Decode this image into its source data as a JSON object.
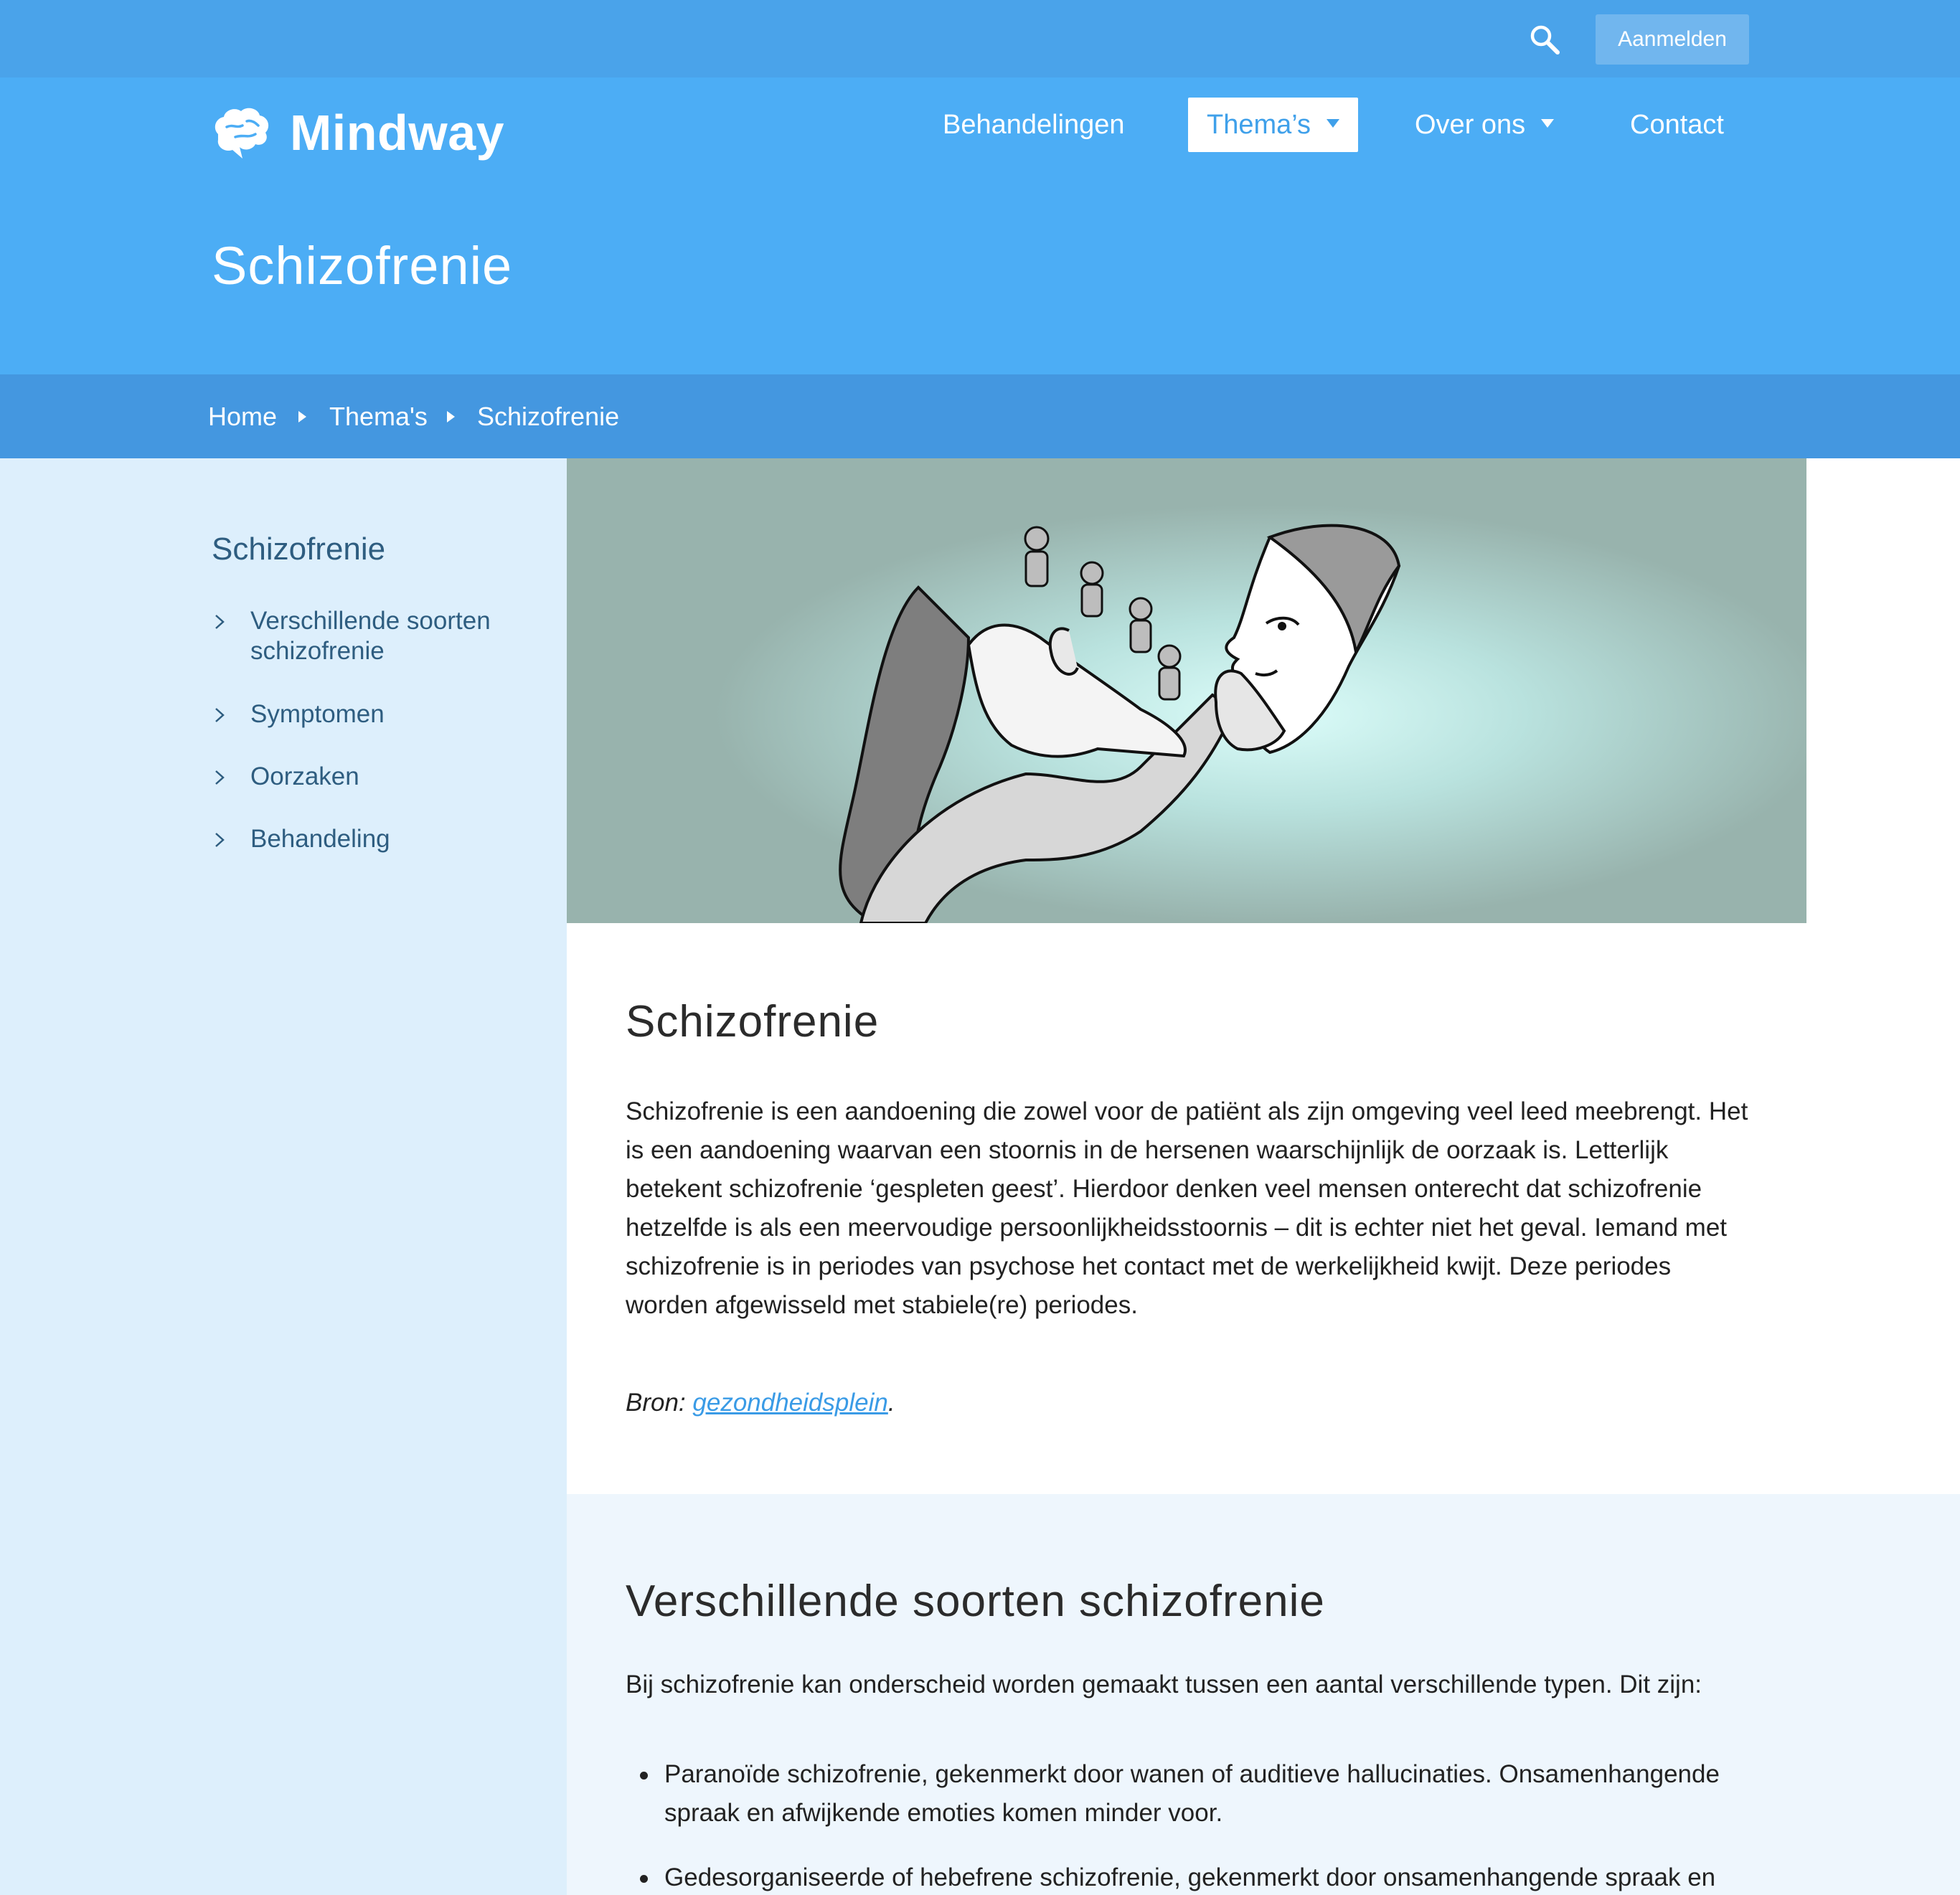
{
  "topbar": {
    "search_icon": "search-icon",
    "signin_label": "Aanmelden"
  },
  "brand": {
    "name": "Mindway",
    "icon": "brain-icon",
    "colors": {
      "topbar": "#4aa3ea",
      "header": "#4cadf5",
      "breadcrumb": "#4497e0",
      "sidebar": "#ddeffc",
      "link": "#3a9be6"
    }
  },
  "nav": {
    "items": [
      {
        "label": "Behandelingen",
        "dropdown": false,
        "active": false
      },
      {
        "label": "Thema’s",
        "dropdown": true,
        "active": true
      },
      {
        "label": "Over ons",
        "dropdown": true,
        "active": false
      },
      {
        "label": "Contact",
        "dropdown": false,
        "active": false
      }
    ]
  },
  "page": {
    "title": "Schizofrenie"
  },
  "breadcrumb": {
    "items": [
      "Home",
      "Thema's",
      "Schizofrenie"
    ]
  },
  "sidebar": {
    "title": "Schizofrenie",
    "items": [
      {
        "label": "Verschillende soorten schizofrenie"
      },
      {
        "label": "Symptomen"
      },
      {
        "label": "Oorzaken"
      },
      {
        "label": "Behandeling"
      }
    ]
  },
  "hero": {
    "alt": "Illustratie van een figuur die een masker vasthoudt met kleine figuurtjes die op het hoofd klimmen"
  },
  "intro": {
    "heading": "Schizofrenie",
    "body": "Schizofrenie is een aandoening die zowel voor de patiënt als zijn omgeving veel leed meebrengt. Het is een aandoening waarvan een stoornis in de hersenen waarschijnlijk de oorzaak is. Letterlijk betekent schizofrenie ‘gespleten geest’. Hierdoor denken veel mensen onterecht dat schizofrenie hetzelfde is als een meervoudige persoonlijkheidsstoornis – dit is echter niet het geval. Iemand met schizofrenie is in periodes van psychose het contact met de werkelijkheid kwijt. Deze periodes worden afgewisseld met stabiele(re) periodes.",
    "source_prefix": "Bron: ",
    "source_link": "gezondheidsplein",
    "source_suffix": "."
  },
  "types": {
    "heading": "Verschillende soorten schizofrenie",
    "intro": "Bij schizofrenie kan onderscheid worden gemaakt tussen een aantal verschillende typen. Dit zijn:",
    "items": [
      "Paranoïde schizofrenie, gekenmerkt door wanen of auditieve hallucinaties. Onsamenhangende spraak en afwijkende emoties komen minder voor.",
      "Gedesorganiseerde of hebefrene schizofrenie, gekenmerkt door onsamenhangende spraak en"
    ]
  }
}
